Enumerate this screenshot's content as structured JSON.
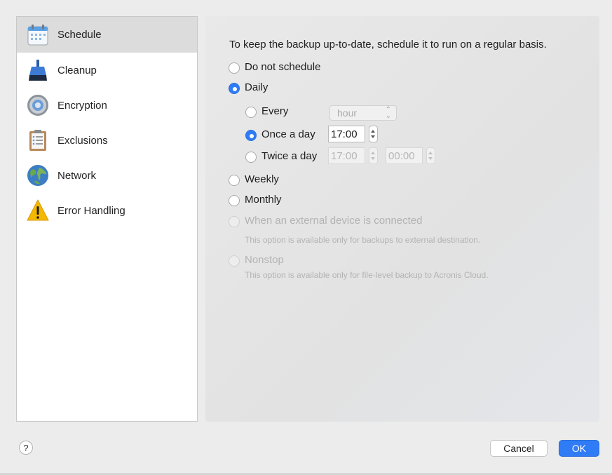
{
  "sidebar": {
    "items": [
      {
        "label": "Schedule",
        "icon": "calendar-icon",
        "selected": true
      },
      {
        "label": "Cleanup",
        "icon": "broom-icon",
        "selected": false
      },
      {
        "label": "Encryption",
        "icon": "vault-icon",
        "selected": false
      },
      {
        "label": "Exclusions",
        "icon": "clipboard-icon",
        "selected": false
      },
      {
        "label": "Network",
        "icon": "globe-icon",
        "selected": false
      },
      {
        "label": "Error Handling",
        "icon": "warning-icon",
        "selected": false
      }
    ]
  },
  "schedule": {
    "intro": "To keep the backup up-to-date, schedule it to run on a regular basis.",
    "options": {
      "do_not_schedule": "Do not schedule",
      "daily": "Daily",
      "weekly": "Weekly",
      "monthly": "Monthly",
      "external_device": "When an external device is connected",
      "external_device_note": "This option is available only for backups to external destination.",
      "nonstop": "Nonstop",
      "nonstop_note": "This option is available only for file-level backup to Acronis Cloud."
    },
    "selected": "daily",
    "daily": {
      "every_label": "Every",
      "every_unit": "hour",
      "once_label": "Once a day",
      "once_time": "17:00",
      "twice_label": "Twice a day",
      "twice_time1": "17:00",
      "twice_time2": "00:00",
      "selected": "once"
    }
  },
  "footer": {
    "help": "?",
    "cancel": "Cancel",
    "ok": "OK"
  },
  "colors": {
    "accent": "#2f7cf6",
    "selected_row": "#dcdcdc"
  }
}
